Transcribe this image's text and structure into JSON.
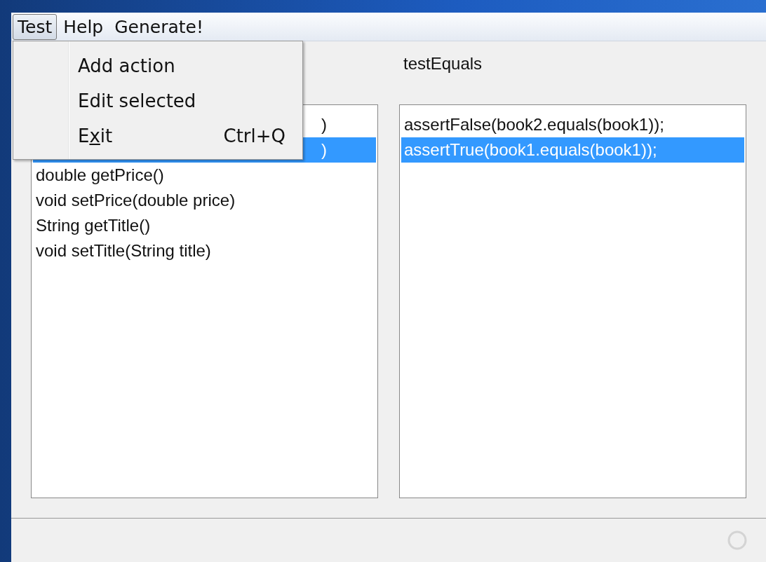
{
  "menubar": [
    {
      "label": "Test",
      "selected": true
    },
    {
      "label": "Help",
      "selected": false
    },
    {
      "label": "Generate!",
      "selected": false
    }
  ],
  "menu": {
    "items": [
      {
        "label": "Add action"
      },
      {
        "label": "Edit selected"
      },
      {
        "label": "Exit",
        "shortcut": "Ctrl+Q"
      }
    ]
  },
  "left_list": {
    "items": [
      {
        "kind": "covered",
        "text": ")",
        "selected": false
      },
      {
        "kind": "covered",
        "text": ")",
        "selected": true
      },
      {
        "kind": "plain",
        "text": "double getPrice()",
        "selected": false
      },
      {
        "kind": "plain",
        "text": "void setPrice(double price)",
        "selected": false
      },
      {
        "kind": "plain",
        "text": "String getTitle()",
        "selected": false
      },
      {
        "kind": "plain",
        "text": "void setTitle(String title)",
        "selected": false
      }
    ]
  },
  "right_panel": {
    "label": "testEquals",
    "items": [
      {
        "text": "assertFalse(book2.equals(book1));",
        "selected": false
      },
      {
        "text": "assertTrue(book1.equals(book1));",
        "selected": true
      }
    ]
  }
}
